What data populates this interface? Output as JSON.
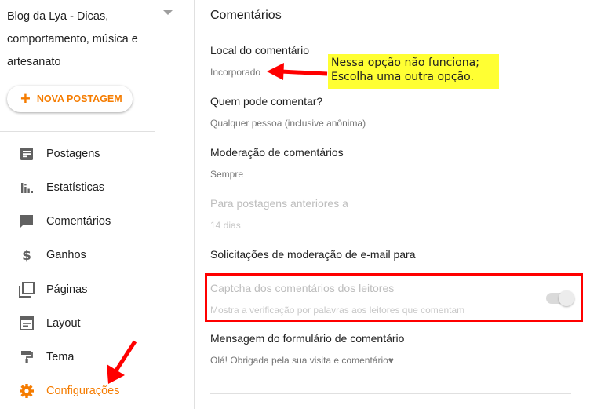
{
  "sidebar": {
    "blog_title": "Blog da Lya - Dicas, comportamento, música e artesanato",
    "new_post_label": "NOVA POSTAGEM",
    "items": [
      {
        "label": "Postagens",
        "icon": "posts-icon"
      },
      {
        "label": "Estatísticas",
        "icon": "stats-icon"
      },
      {
        "label": "Comentários",
        "icon": "comments-icon"
      },
      {
        "label": "Ganhos",
        "icon": "dollar-icon"
      },
      {
        "label": "Páginas",
        "icon": "pages-icon"
      },
      {
        "label": "Layout",
        "icon": "layout-icon"
      },
      {
        "label": "Tema",
        "icon": "paint-roller-icon"
      },
      {
        "label": "Configurações",
        "icon": "gear-icon",
        "active": true
      }
    ]
  },
  "main": {
    "section_title": "Comentários",
    "settings": [
      {
        "label": "Local do comentário",
        "value": "Incorporado"
      },
      {
        "label": "Quem pode comentar?",
        "value": "Qualquer pessoa (inclusive anônima)"
      },
      {
        "label": "Moderação de comentários",
        "value": "Sempre"
      },
      {
        "label": "Para postagens anteriores a",
        "value": "14 dias",
        "disabled": true
      },
      {
        "label": "Solicitações de moderação de e-mail para",
        "value": ""
      },
      {
        "label": "Captcha dos comentários dos leitores",
        "value": "Mostra a verificação por palavras aos leitores que comentam",
        "disabled": true,
        "toggle": true
      },
      {
        "label": "Mensagem do formulário de comentário",
        "value": "Olá! Obrigada pela sua visita e comentário♥"
      }
    ]
  },
  "annotation": {
    "note_line1": "Nessa opção não funciona;",
    "note_line2": "Escolha uma outra opção."
  },
  "colors": {
    "accent": "#f57c00",
    "annotation_red": "#ff0000",
    "note_yellow": "#ffff33",
    "icon_gray": "#616161"
  }
}
